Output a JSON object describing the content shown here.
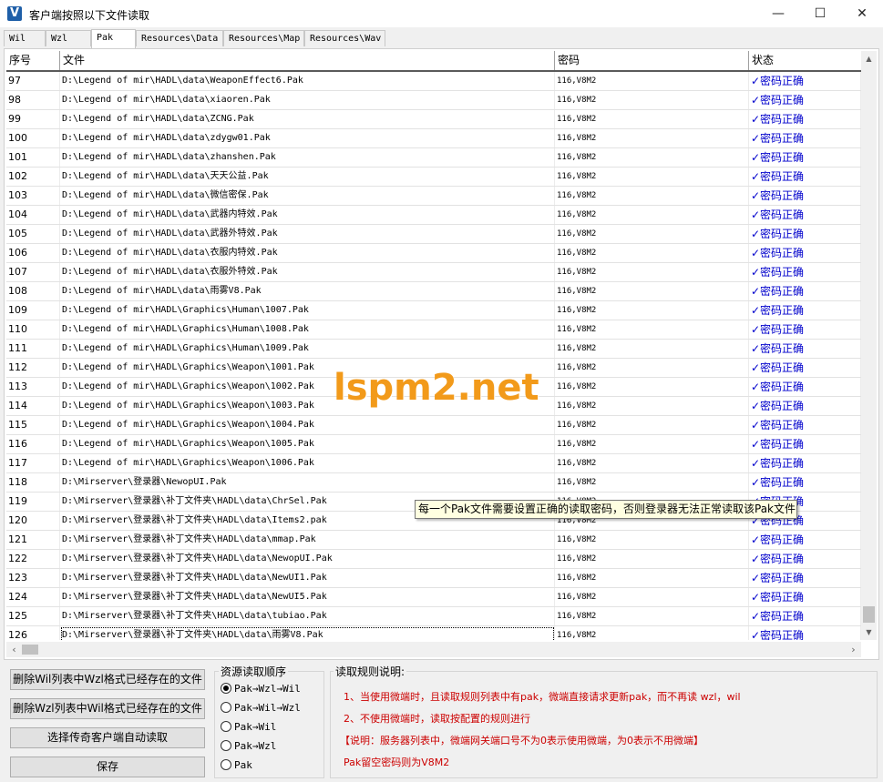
{
  "window": {
    "title": "客户端按照以下文件读取",
    "icon_letter": "V",
    "minimize": "—",
    "maximize": "☐",
    "close": "✕"
  },
  "tabs": [
    "Wil",
    "Wzl",
    "Pak",
    "Resources\\Data",
    "Resources\\Map",
    "Resources\\Wav"
  ],
  "active_tab": "Pak",
  "table": {
    "headers": [
      "序号",
      "文件",
      "密码",
      "状态"
    ],
    "rows": [
      [
        "97",
        "D:\\Legend of mir\\HADL\\data\\WeaponEffect6.Pak",
        "116,V8M2",
        "✓密码正确"
      ],
      [
        "98",
        "D:\\Legend of mir\\HADL\\data\\xiaoren.Pak",
        "116,V8M2",
        "✓密码正确"
      ],
      [
        "99",
        "D:\\Legend of mir\\HADL\\data\\ZCNG.Pak",
        "116,V8M2",
        "✓密码正确"
      ],
      [
        "100",
        "D:\\Legend of mir\\HADL\\data\\zdygw01.Pak",
        "116,V8M2",
        "✓密码正确"
      ],
      [
        "101",
        "D:\\Legend of mir\\HADL\\data\\zhanshen.Pak",
        "116,V8M2",
        "✓密码正确"
      ],
      [
        "102",
        "D:\\Legend of mir\\HADL\\data\\天天公益.Pak",
        "116,V8M2",
        "✓密码正确"
      ],
      [
        "103",
        "D:\\Legend of mir\\HADL\\data\\微信密保.Pak",
        "116,V8M2",
        "✓密码正确"
      ],
      [
        "104",
        "D:\\Legend of mir\\HADL\\data\\武器内特效.Pak",
        "116,V8M2",
        "✓密码正确"
      ],
      [
        "105",
        "D:\\Legend of mir\\HADL\\data\\武器外特效.Pak",
        "116,V8M2",
        "✓密码正确"
      ],
      [
        "106",
        "D:\\Legend of mir\\HADL\\data\\衣服内特效.Pak",
        "116,V8M2",
        "✓密码正确"
      ],
      [
        "107",
        "D:\\Legend of mir\\HADL\\data\\衣服外特效.Pak",
        "116,V8M2",
        "✓密码正确"
      ],
      [
        "108",
        "D:\\Legend of mir\\HADL\\data\\雨雾V8.Pak",
        "116,V8M2",
        "✓密码正确"
      ],
      [
        "109",
        "D:\\Legend of mir\\HADL\\Graphics\\Human\\1007.Pak",
        "116,V8M2",
        "✓密码正确"
      ],
      [
        "110",
        "D:\\Legend of mir\\HADL\\Graphics\\Human\\1008.Pak",
        "116,V8M2",
        "✓密码正确"
      ],
      [
        "111",
        "D:\\Legend of mir\\HADL\\Graphics\\Human\\1009.Pak",
        "116,V8M2",
        "✓密码正确"
      ],
      [
        "112",
        "D:\\Legend of mir\\HADL\\Graphics\\Weapon\\1001.Pak",
        "116,V8M2",
        "✓密码正确"
      ],
      [
        "113",
        "D:\\Legend of mir\\HADL\\Graphics\\Weapon\\1002.Pak",
        "116,V8M2",
        "✓密码正确"
      ],
      [
        "114",
        "D:\\Legend of mir\\HADL\\Graphics\\Weapon\\1003.Pak",
        "116,V8M2",
        "✓密码正确"
      ],
      [
        "115",
        "D:\\Legend of mir\\HADL\\Graphics\\Weapon\\1004.Pak",
        "116,V8M2",
        "✓密码正确"
      ],
      [
        "116",
        "D:\\Legend of mir\\HADL\\Graphics\\Weapon\\1005.Pak",
        "116,V8M2",
        "✓密码正确"
      ],
      [
        "117",
        "D:\\Legend of mir\\HADL\\Graphics\\Weapon\\1006.Pak",
        "116,V8M2",
        "✓密码正确"
      ],
      [
        "118",
        "D:\\Mirserver\\登录器\\NewopUI.Pak",
        "116,V8M2",
        "✓密码正确"
      ],
      [
        "119",
        "D:\\Mirserver\\登录器\\补丁文件夹\\HADL\\data\\ChrSel.Pak",
        "116,V8M2",
        "✓密码正确"
      ],
      [
        "120",
        "D:\\Mirserver\\登录器\\补丁文件夹\\HADL\\data\\Items2.pak",
        "116,V8M2",
        "✓密码正确"
      ],
      [
        "121",
        "D:\\Mirserver\\登录器\\补丁文件夹\\HADL\\data\\mmap.Pak",
        "116,V8M2",
        "✓密码正确"
      ],
      [
        "122",
        "D:\\Mirserver\\登录器\\补丁文件夹\\HADL\\data\\NewopUI.Pak",
        "116,V8M2",
        "✓密码正确"
      ],
      [
        "123",
        "D:\\Mirserver\\登录器\\补丁文件夹\\HADL\\data\\NewUI1.Pak",
        "116,V8M2",
        "✓密码正确"
      ],
      [
        "124",
        "D:\\Mirserver\\登录器\\补丁文件夹\\HADL\\data\\NewUI5.Pak",
        "116,V8M2",
        "✓密码正确"
      ],
      [
        "125",
        "D:\\Mirserver\\登录器\\补丁文件夹\\HADL\\data\\tubiao.Pak",
        "116,V8M2",
        "✓密码正确"
      ],
      [
        "126",
        "D:\\Mirserver\\登录器\\补丁文件夹\\HADL\\data\\雨雾V8.Pak",
        "116,V8M2",
        "✓密码正确"
      ]
    ],
    "selected_index": "126"
  },
  "tooltip": "每一个Pak文件需要设置正确的读取密码，否则登录器无法正常读取该Pak文件",
  "watermark": "lspm2.net",
  "buttons": {
    "delete_wil": "删除Wil列表中Wzl格式已经存在的文件",
    "delete_wzl": "删除Wzl列表中Wil格式已经存在的文件",
    "auto_read": "选择传奇客户端自动读取",
    "save": "保存"
  },
  "read_order": {
    "title": "资源读取顺序",
    "options": [
      "Pak→Wzl→Wil",
      "Pak→Wil→Wzl",
      "Pak→Wil",
      "Pak→Wzl",
      "Pak"
    ],
    "selected": "Pak→Wzl→Wil"
  },
  "rules": {
    "title": "读取规则说明:",
    "line1": "1、当使用微端时，且读取规则列表中有pak，微端直接请求更新pak，而不再读 wzl，wil",
    "line2": "2、不使用微端时，读取按配置的规则进行",
    "line3": "【说明：服务器列表中，微端网关端口号不为0表示使用微端，为0表示不用微端】",
    "line4": "Pak留空密码则为V8M2"
  },
  "colors": {
    "status_ok": "#0000cc",
    "rules_text": "#cc0000",
    "watermark": "#f29a1a"
  }
}
